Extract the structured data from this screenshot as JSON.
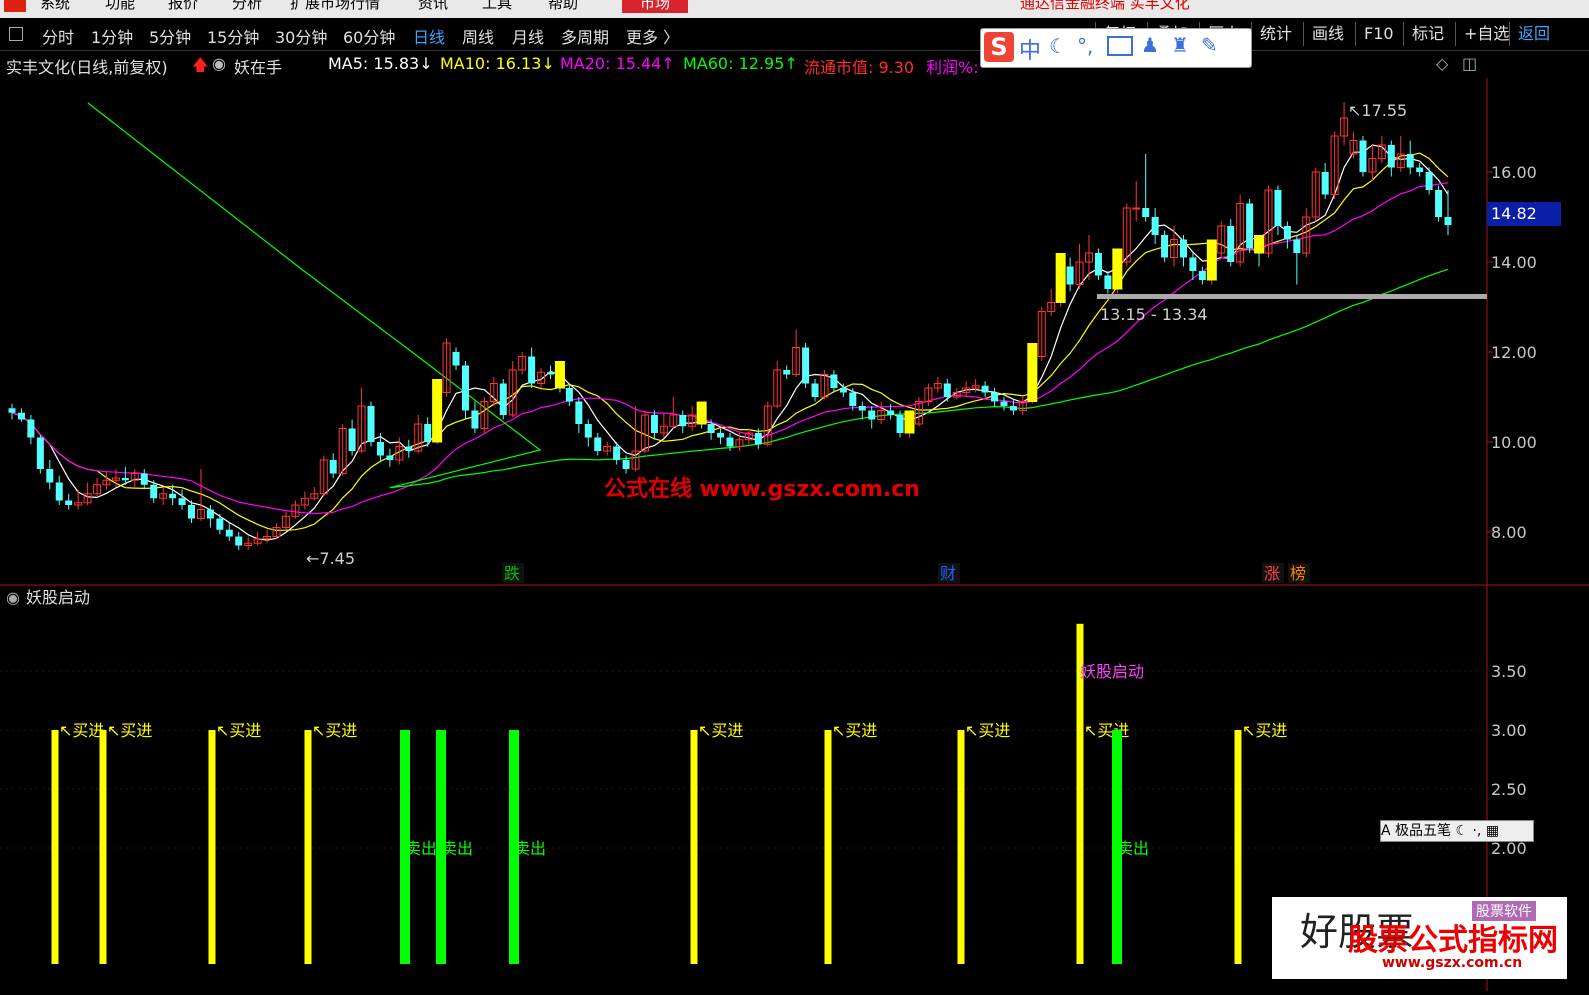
{
  "menubar": {
    "items": [
      "系统",
      "功能",
      "报价",
      "分析",
      "扩展市场行情",
      "资讯",
      "工具",
      "帮助"
    ],
    "highlight": "市场",
    "title": "通达信金融终端 实丰文化"
  },
  "toolbar": {
    "periods": [
      "分时",
      "1分钟",
      "5分钟",
      "15分钟",
      "30分钟",
      "60分钟",
      "日线",
      "周线",
      "月线",
      "多周期",
      "更多 〉"
    ],
    "active": "日线",
    "right_buttons": [
      "复权",
      "叠加",
      "历史",
      "统计",
      "画线",
      "F10",
      "标记",
      "+自选",
      "返回"
    ],
    "ime": "中"
  },
  "info": {
    "stock": "实丰文化(日线,前复权)",
    "indicator": "妖在手",
    "ma5": "MA5: 15.83↓",
    "ma10": "MA10: 16.13↓",
    "ma20": "MA20: 15.44↑",
    "ma60": "MA60: 12.95↑",
    "mktcap": "流通市值: 9.30",
    "profit": "利润%: "
  },
  "chart_data": [
    {
      "type": "candlestick",
      "title": "实丰文化(日线,前复权)",
      "yticks": [
        "16.00",
        "14.00",
        "12.00",
        "10.00",
        "8.00"
      ],
      "ylim": [
        7.0,
        17.9
      ],
      "current_price": "14.82",
      "annotations": [
        "17.55",
        "7.45",
        "13.15 - 13.34"
      ],
      "event_markers": [
        "跌",
        "财",
        "涨",
        "榜"
      ],
      "watermark": "公式在线  www.gszx.com.cn",
      "candles": [
        [
          10.75,
          10.65,
          10.85,
          10.5
        ],
        [
          10.65,
          10.5,
          10.75,
          10.45
        ],
        [
          10.5,
          10.1,
          10.6,
          9.95
        ],
        [
          10.1,
          9.4,
          10.15,
          9.3
        ],
        [
          9.4,
          9.1,
          9.6,
          8.95
        ],
        [
          9.1,
          8.7,
          9.25,
          8.6
        ],
        [
          8.7,
          8.6,
          8.85,
          8.5
        ],
        [
          8.6,
          8.65,
          8.95,
          8.5
        ],
        [
          8.65,
          8.85,
          9.1,
          8.6
        ],
        [
          8.85,
          9.05,
          9.2,
          8.8
        ],
        [
          9.05,
          9.15,
          9.35,
          8.95
        ],
        [
          9.15,
          9.2,
          9.4,
          9.0
        ],
        [
          9.2,
          9.15,
          9.45,
          9.05
        ],
        [
          9.15,
          9.3,
          9.4,
          9.0
        ],
        [
          9.3,
          9.05,
          9.4,
          8.95
        ],
        [
          9.05,
          8.75,
          9.15,
          8.65
        ],
        [
          8.75,
          8.85,
          9.0,
          8.6
        ],
        [
          8.85,
          8.75,
          9.05,
          8.6
        ],
        [
          8.75,
          8.6,
          8.95,
          8.5
        ],
        [
          8.6,
          8.3,
          8.7,
          8.2
        ],
        [
          8.3,
          8.5,
          9.4,
          8.25
        ],
        [
          8.5,
          8.3,
          8.6,
          8.1
        ],
        [
          8.3,
          8.05,
          8.4,
          7.95
        ],
        [
          8.05,
          7.9,
          8.2,
          7.8
        ],
        [
          7.9,
          7.7,
          8.0,
          7.6
        ],
        [
          7.7,
          7.75,
          7.9,
          7.6
        ],
        [
          7.75,
          7.85,
          8.0,
          7.7
        ],
        [
          7.85,
          7.9,
          8.05,
          7.75
        ],
        [
          7.9,
          8.1,
          8.2,
          7.85
        ],
        [
          8.1,
          8.35,
          8.45,
          8.05
        ],
        [
          8.35,
          8.6,
          8.7,
          8.3
        ],
        [
          8.6,
          8.75,
          8.9,
          8.5
        ],
        [
          8.75,
          8.85,
          9.0,
          8.7
        ],
        [
          8.85,
          9.6,
          9.7,
          8.8
        ],
        [
          9.6,
          9.3,
          9.75,
          9.2
        ],
        [
          9.3,
          10.3,
          10.4,
          9.25
        ],
        [
          10.3,
          9.8,
          10.5,
          9.7
        ],
        [
          9.8,
          10.8,
          11.2,
          9.75
        ],
        [
          10.8,
          10.0,
          10.9,
          9.9
        ],
        [
          10.0,
          9.7,
          10.2,
          9.55
        ],
        [
          9.7,
          9.6,
          9.85,
          9.45
        ],
        [
          9.6,
          9.9,
          10.1,
          9.5
        ],
        [
          9.9,
          9.8,
          10.05,
          9.65
        ],
        [
          9.8,
          10.4,
          10.6,
          9.75
        ],
        [
          10.4,
          10.0,
          10.55,
          9.9
        ],
        [
          10.0,
          11.1,
          11.3,
          9.95
        ],
        [
          11.1,
          12.2,
          12.3,
          11.0
        ],
        [
          12.0,
          11.7,
          12.1,
          11.6
        ],
        [
          11.7,
          10.7,
          11.8,
          10.5
        ],
        [
          10.7,
          10.3,
          10.9,
          10.2
        ],
        [
          10.3,
          10.9,
          11.0,
          10.2
        ],
        [
          10.9,
          11.3,
          11.45,
          10.8
        ],
        [
          11.3,
          10.6,
          11.4,
          10.5
        ],
        [
          10.6,
          11.6,
          11.8,
          10.55
        ],
        [
          11.6,
          11.9,
          12.0,
          11.5
        ],
        [
          11.9,
          11.3,
          12.1,
          11.2
        ],
        [
          11.3,
          11.55,
          11.65,
          11.2
        ],
        [
          11.55,
          11.5,
          11.7,
          11.4
        ],
        [
          11.5,
          11.2,
          11.65,
          11.1
        ],
        [
          11.2,
          10.9,
          11.3,
          10.8
        ],
        [
          10.9,
          10.4,
          11.0,
          10.2
        ],
        [
          10.4,
          10.1,
          10.5,
          9.9
        ],
        [
          10.1,
          9.8,
          10.2,
          9.7
        ],
        [
          9.8,
          9.9,
          10.0,
          9.7
        ],
        [
          9.9,
          9.6,
          10.0,
          9.5
        ],
        [
          9.6,
          9.4,
          9.7,
          9.3
        ],
        [
          9.4,
          9.8,
          10.8,
          9.35
        ],
        [
          9.8,
          10.6,
          10.7,
          9.75
        ],
        [
          10.6,
          10.2,
          10.7,
          10.05
        ],
        [
          10.2,
          10.35,
          10.65,
          10.1
        ],
        [
          10.35,
          10.6,
          11.0,
          10.3
        ],
        [
          10.6,
          10.35,
          10.7,
          10.2
        ],
        [
          10.35,
          10.6,
          10.8,
          10.25
        ],
        [
          10.6,
          10.4,
          10.75,
          10.3
        ],
        [
          10.4,
          10.2,
          10.5,
          10.05
        ],
        [
          10.2,
          10.1,
          10.3,
          9.95
        ],
        [
          10.1,
          9.9,
          10.2,
          9.8
        ],
        [
          9.9,
          10.05,
          10.2,
          9.8
        ],
        [
          10.05,
          10.2,
          10.3,
          9.95
        ],
        [
          10.2,
          9.95,
          10.3,
          9.85
        ],
        [
          9.95,
          10.8,
          10.9,
          9.9
        ],
        [
          10.8,
          11.6,
          11.8,
          10.75
        ],
        [
          11.6,
          11.5,
          11.7,
          11.4
        ],
        [
          11.5,
          12.1,
          12.5,
          11.45
        ],
        [
          12.1,
          11.3,
          12.2,
          11.2
        ],
        [
          11.3,
          11.0,
          11.4,
          10.9
        ],
        [
          11.0,
          11.5,
          11.6,
          10.95
        ],
        [
          11.5,
          11.2,
          11.6,
          11.1
        ],
        [
          11.2,
          11.1,
          11.3,
          11.0
        ],
        [
          11.1,
          10.8,
          11.2,
          10.7
        ],
        [
          10.8,
          10.7,
          10.9,
          10.5
        ],
        [
          10.7,
          10.5,
          10.8,
          10.3
        ],
        [
          10.5,
          10.7,
          10.9,
          10.4
        ],
        [
          10.7,
          10.6,
          10.85,
          10.5
        ],
        [
          10.6,
          10.2,
          10.7,
          10.1
        ],
        [
          10.2,
          10.4,
          10.5,
          10.1
        ],
        [
          10.4,
          10.9,
          11.0,
          10.35
        ],
        [
          10.9,
          11.2,
          11.3,
          10.8
        ],
        [
          11.2,
          11.3,
          11.45,
          11.1
        ],
        [
          11.3,
          11.0,
          11.4,
          10.9
        ],
        [
          11.0,
          11.1,
          11.2,
          10.95
        ],
        [
          11.1,
          11.2,
          11.35,
          11.0
        ],
        [
          11.2,
          11.25,
          11.4,
          11.1
        ],
        [
          11.25,
          11.1,
          11.35,
          11.0
        ],
        [
          11.1,
          10.9,
          11.2,
          10.8
        ],
        [
          10.9,
          10.8,
          11.0,
          10.7
        ],
        [
          10.8,
          10.7,
          10.95,
          10.6
        ],
        [
          10.7,
          10.9,
          11.0,
          10.6
        ],
        [
          10.9,
          11.9,
          12.0,
          10.85
        ],
        [
          11.9,
          12.9,
          13.0,
          11.8
        ],
        [
          12.9,
          13.1,
          13.4,
          12.8
        ],
        [
          13.1,
          13.9,
          14.0,
          13.0
        ],
        [
          13.9,
          13.5,
          14.1,
          13.35
        ],
        [
          13.5,
          14.0,
          14.4,
          13.4
        ],
        [
          14.0,
          14.2,
          14.6,
          13.6
        ],
        [
          14.2,
          13.7,
          14.3,
          13.6
        ],
        [
          13.7,
          13.4,
          13.8,
          13.3
        ],
        [
          13.4,
          14.0,
          14.1,
          13.3
        ],
        [
          14.0,
          15.2,
          15.3,
          13.9
        ],
        [
          15.2,
          15.2,
          15.8,
          14.9
        ],
        [
          15.2,
          15.0,
          16.4,
          14.9
        ],
        [
          15.0,
          14.6,
          15.2,
          14.4
        ],
        [
          14.6,
          14.1,
          14.7,
          14.0
        ],
        [
          14.1,
          14.5,
          14.8,
          13.9
        ],
        [
          14.5,
          14.1,
          14.6,
          13.9
        ],
        [
          14.1,
          13.8,
          14.2,
          13.6
        ],
        [
          13.8,
          13.6,
          13.9,
          13.5
        ],
        [
          13.6,
          14.2,
          14.3,
          13.5
        ],
        [
          14.2,
          14.8,
          14.9,
          14.1
        ],
        [
          14.8,
          14.0,
          14.95,
          13.9
        ],
        [
          14.0,
          15.3,
          15.5,
          13.9
        ],
        [
          15.3,
          14.3,
          15.4,
          14.2
        ],
        [
          14.3,
          14.2,
          14.4,
          13.9
        ],
        [
          14.2,
          15.6,
          15.7,
          14.1
        ],
        [
          15.6,
          14.8,
          15.7,
          14.6
        ],
        [
          14.8,
          14.5,
          14.9,
          14.3
        ],
        [
          14.5,
          14.2,
          14.6,
          13.5
        ],
        [
          14.2,
          15.0,
          15.2,
          14.1
        ],
        [
          15.0,
          16.0,
          16.1,
          14.9
        ],
        [
          16.0,
          15.5,
          16.2,
          15.4
        ],
        [
          15.5,
          16.8,
          16.9,
          15.4
        ],
        [
          16.8,
          17.2,
          17.55,
          16.6
        ],
        [
          16.4,
          16.7,
          16.9,
          16.3
        ],
        [
          16.7,
          16.0,
          16.8,
          15.9
        ],
        [
          16.0,
          16.3,
          16.6,
          15.8
        ],
        [
          16.3,
          16.6,
          16.8,
          16.2
        ],
        [
          16.6,
          16.1,
          16.7,
          15.9
        ],
        [
          16.1,
          16.4,
          16.8,
          16.0
        ],
        [
          16.4,
          16.1,
          16.7,
          15.95
        ],
        [
          16.1,
          16.0,
          16.2,
          15.9
        ],
        [
          16.0,
          15.6,
          16.1,
          15.5
        ],
        [
          15.6,
          15.0,
          15.7,
          14.9
        ],
        [
          15.0,
          14.82,
          15.6,
          14.6
        ]
      ]
    },
    {
      "type": "bar",
      "title": "妖股启动",
      "yticks": [
        "3.50",
        "3.00",
        "2.50",
        "2.00"
      ],
      "ylim": [
        0,
        4.0
      ],
      "buy_label": "买进",
      "sell_label": "卖出",
      "launch_label": "妖股启动",
      "bars": [
        {
          "x": 4,
          "value": 3,
          "kind": "buy"
        },
        {
          "x": 8,
          "value": 3,
          "kind": "buy"
        },
        {
          "x": 18,
          "value": 3,
          "kind": "buy"
        },
        {
          "x": 26,
          "value": 3,
          "kind": "buy"
        },
        {
          "x": 34,
          "value": 3,
          "kind": "sell"
        },
        {
          "x": 37,
          "value": 3,
          "kind": "sell"
        },
        {
          "x": 43,
          "value": 3,
          "kind": "sell"
        },
        {
          "x": 59,
          "value": 3,
          "kind": "buy"
        },
        {
          "x": 71,
          "value": 3,
          "kind": "buy"
        },
        {
          "x": 82,
          "value": 3,
          "kind": "buy"
        },
        {
          "x": 92,
          "value": 3.9,
          "kind": "launch"
        },
        {
          "x": 95,
          "value": 3,
          "kind": "sell"
        },
        {
          "x": 106,
          "value": 3,
          "kind": "buy"
        }
      ]
    }
  ],
  "ime2": "A 极品五笔",
  "watermark": {
    "big": "好股票",
    "red": "股票公式指标网",
    "url": "www.gszx.com.cn",
    "tag": "股票软件"
  },
  "colors": {
    "up": "#ff3333",
    "down": "#54ffff",
    "ma5": "#ffffff",
    "ma10": "#ffff00",
    "ma20": "#ff00ff",
    "ma60": "#00ff00",
    "buy": "#ffff00",
    "sell": "#00ff00"
  }
}
